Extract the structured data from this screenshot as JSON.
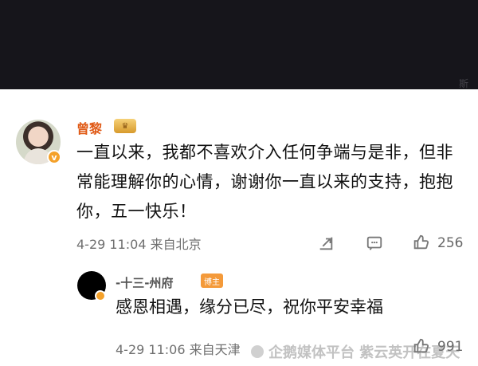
{
  "header": {
    "faint_text": "斯"
  },
  "main_comment": {
    "author": "曾黎",
    "text": "一直以来，我都不喜欢介入任何争端与是非，但非常能理解你的心情，谢谢你一直以来的支持，抱抱你，五一快乐！",
    "time_location": "4-29 11:04 来自北京",
    "like_count": "256",
    "icons": {
      "share": "share-icon",
      "comment": "comment-icon",
      "like": "like-icon",
      "verified": "verified-icon",
      "crown": "crown-icon"
    }
  },
  "reply": {
    "author": "-十三-州府",
    "badge": "博主",
    "text": "感恩相遇，缘分已尽，祝你平安幸福",
    "time_location": "4-29 11:06 来自天津",
    "like_count": "991"
  },
  "watermark": {
    "text": "企鹅媒体平台 紫云英开在夏天"
  },
  "colors": {
    "header_bg": "#16151b",
    "username": "#e05a16",
    "badge": "#f49a3a",
    "text": "#111111",
    "meta": "#6f6f6f"
  }
}
